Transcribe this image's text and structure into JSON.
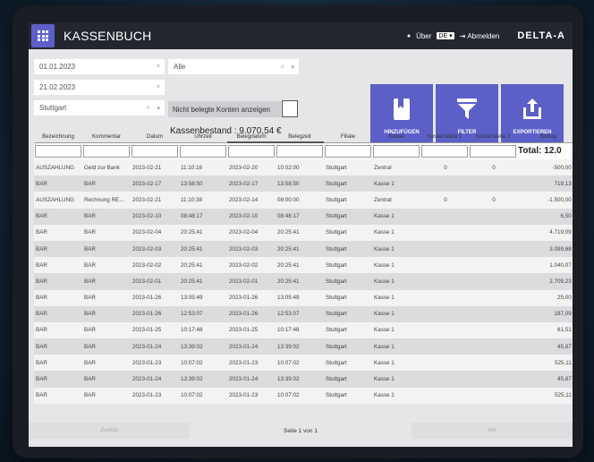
{
  "app": {
    "title": "KASSENBUCH",
    "brand": "DELTA-A"
  },
  "topbar": {
    "about": "Über",
    "language": "DE",
    "logout": "Abmelden"
  },
  "filters": {
    "date_from": "01.01.2023",
    "date_to": "21.02.2023",
    "branch": "Stuttgart",
    "account_select": "Alle",
    "toggle_label": "Nicht belegte Konten anzeigen",
    "balance": "Kassenbestand : 9.070,54 €"
  },
  "actions": {
    "add": "HINZUFÜGEN",
    "filter": "FILTER",
    "export": "EXPORTIEREN"
  },
  "table": {
    "columns": [
      "Bezeichnung",
      "Kommentar",
      "Datum",
      "Uhrzeit",
      "Belegdatum",
      "Belegzeit",
      "Filiale",
      "Kasse",
      "Kostenstelle 1",
      "Kostenstelle 2",
      "Betrag"
    ],
    "total": "Total: 12.0",
    "rows": [
      [
        "AUSZAHLUNG",
        "Geld zur Bank",
        "2023-02-21",
        "11:10:16",
        "2023-02-20",
        "10:02:00",
        "Stuttgart",
        "Zentral",
        "0",
        "0",
        "-500,00 €"
      ],
      [
        "BAR",
        "BAR",
        "2023-02-17",
        "13:58:50",
        "2023-02-17",
        "13:58:50",
        "Stuttgart",
        "Kasse 1",
        "",
        "",
        "719,13 €"
      ],
      [
        "AUSZAHLUNG",
        "Rechnung RE...",
        "2023-02-21",
        "11:10:38",
        "2023-02-14",
        "08:00:00",
        "Stuttgart",
        "Zentral",
        "0",
        "0",
        "-1.500,00 €"
      ],
      [
        "BAR",
        "BAR",
        "2023-02-10",
        "08:48:17",
        "2023-02-10",
        "08:48:17",
        "Stuttgart",
        "Kasse 1",
        "",
        "",
        "6,50 €"
      ],
      [
        "BAR",
        "BAR",
        "2023-02-04",
        "20:25:41",
        "2023-02-04",
        "20:25:41",
        "Stuttgart",
        "Kasse 1",
        "",
        "",
        "4.719,09 €"
      ],
      [
        "BAR",
        "BAR",
        "2023-02-03",
        "20:25:41",
        "2023-02-03",
        "20:25:41",
        "Stuttgart",
        "Kasse 1",
        "",
        "",
        "3.099,68 €"
      ],
      [
        "BAR",
        "BAR",
        "2023-02-02",
        "20:25:41",
        "2023-02-02",
        "20:25:41",
        "Stuttgart",
        "Kasse 1",
        "",
        "",
        "1.040,07 €"
      ],
      [
        "BAR",
        "BAR",
        "2023-02-01",
        "20:25:41",
        "2023-02-01",
        "20:25:41",
        "Stuttgart",
        "Kasse 1",
        "",
        "",
        "2.709,23 €"
      ],
      [
        "BAR",
        "BAR",
        "2023-01-26",
        "13:05:49",
        "2023-01-26",
        "13:05:49",
        "Stuttgart",
        "Kasse 1",
        "",
        "",
        "25,00 €"
      ],
      [
        "BAR",
        "BAR",
        "2023-01-26",
        "12:53:07",
        "2023-01-26",
        "12:53:07",
        "Stuttgart",
        "Kasse 1",
        "",
        "",
        "187,09 €"
      ],
      [
        "BAR",
        "BAR",
        "2023-01-25",
        "10:17:48",
        "2023-01-25",
        "10:17:48",
        "Stuttgart",
        "Kasse 1",
        "",
        "",
        "61,51 €"
      ],
      [
        "BAR",
        "BAR",
        "2023-01-24",
        "13:39:02",
        "2023-01-24",
        "13:39:02",
        "Stuttgart",
        "Kasse 1",
        "",
        "",
        "45,87 €"
      ],
      [
        "BAR",
        "BAR",
        "2023-01-23",
        "10:07:02",
        "2023-01-23",
        "10:07:02",
        "Stuttgart",
        "Kasse 1",
        "",
        "",
        "525,11 €"
      ],
      [
        "BAR",
        "BAR",
        "2023-01-24",
        "13:39:02",
        "2023-01-24",
        "13:39:02",
        "Stuttgart",
        "Kasse 1",
        "",
        "",
        "45,87 €"
      ],
      [
        "BAR",
        "BAR",
        "2023-01-23",
        "10:07:02",
        "2023-01-23",
        "10:07:02",
        "Stuttgart",
        "Kasse 1",
        "",
        "",
        "525,11 €"
      ]
    ]
  },
  "pager": {
    "prev": "Zurück",
    "info": "Seite 1 von 1",
    "next": "Vor"
  },
  "colors": {
    "accent": "#5b5fc7",
    "topbar": "#24262f"
  }
}
